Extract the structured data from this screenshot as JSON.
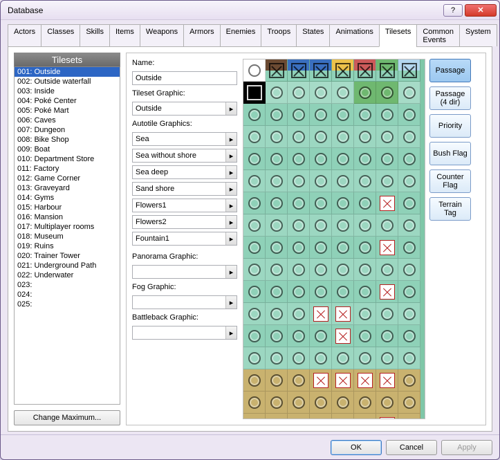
{
  "window_title": "Database",
  "tabs": [
    "Actors",
    "Classes",
    "Skills",
    "Items",
    "Weapons",
    "Armors",
    "Enemies",
    "Troops",
    "States",
    "Animations",
    "Tilesets",
    "Common Events",
    "System"
  ],
  "active_tab_index": 10,
  "list_header": "Tilesets",
  "tilesets": [
    "001: Outside",
    "002: Outside waterfall",
    "003: Inside",
    "004: Poké Center",
    "005: Poké Mart",
    "006: Caves",
    "007: Dungeon",
    "008: Bike Shop",
    "009: Boat",
    "010: Department Store",
    "011: Factory",
    "012: Game Corner",
    "013: Graveyard",
    "014: Gyms",
    "015: Harbour",
    "016: Mansion",
    "017: Multiplayer rooms",
    "018: Museum",
    "019: Ruins",
    "020: Trainer Tower",
    "021: Underground Path",
    "022: Underwater",
    "023:",
    "024:",
    "025:"
  ],
  "selected_index": 0,
  "change_max_label": "Change Maximum...",
  "labels": {
    "name": "Name:",
    "tileset_graphic": "Tileset Graphic:",
    "autotile": "Autotile Graphics:",
    "panorama": "Panorama Graphic:",
    "fog": "Fog Graphic:",
    "battleback": "Battleback Graphic:"
  },
  "fields": {
    "name": "Outside",
    "tileset_graphic": "Outside",
    "autotiles": [
      "Sea",
      "Sea without shore",
      "Sea deep",
      "Sand shore",
      "Flowers1",
      "Flowers2",
      "Fountain1"
    ],
    "panorama": "",
    "fog": "",
    "battleback": ""
  },
  "right_buttons": [
    "Passage",
    "Passage (4 dir)",
    "Priority",
    "Bush Flag",
    "Counter Flag",
    "Terrain Tag"
  ],
  "right_active_index": 0,
  "footer": {
    "ok": "OK",
    "cancel": "Cancel",
    "apply": "Apply"
  },
  "tile_grid": {
    "cols": 8,
    "rows": 17,
    "header_row_bgs": [
      "#fff",
      "#6b4a32",
      "#3a6fbf",
      "#3a6fbf",
      "#edc24a",
      "#cc5a5a",
      "#6fb870",
      "#b4d6ef"
    ],
    "row2_bgs": [
      "#000",
      "#a6dbc7",
      "#a6dbc7",
      "#a6dbc7",
      "#a6dbc7",
      "#6fb870",
      "#6fb870",
      "#a6dbc7"
    ],
    "zones": [
      {
        "rows": "2-14",
        "bg": "#8fd1b8"
      },
      {
        "rows": "15-17",
        "bg": "#c9b26f"
      }
    ],
    "header_marks": [
      "circle",
      "bx",
      "bx",
      "bx",
      "bx",
      "bx",
      "bx",
      "bx"
    ],
    "body_default_mark": "circle",
    "x_cells": [
      [
        7,
        7
      ],
      [
        9,
        7
      ],
      [
        11,
        7
      ],
      [
        12,
        4
      ],
      [
        12,
        5
      ],
      [
        13,
        5
      ],
      [
        15,
        4
      ],
      [
        15,
        5
      ],
      [
        15,
        6
      ],
      [
        15,
        7
      ],
      [
        17,
        7
      ]
    ]
  }
}
